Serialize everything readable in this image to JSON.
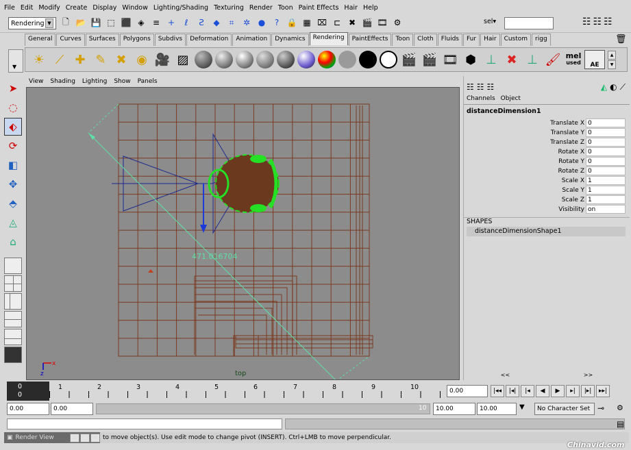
{
  "menu": [
    "File",
    "Edit",
    "Modify",
    "Create",
    "Display",
    "Window",
    "Lighting/Shading",
    "Texturing",
    "Render",
    "Toon",
    "Paint Effects",
    "Hair",
    "Help"
  ],
  "status": {
    "mode": "Rendering",
    "sel_label": "sel▾"
  },
  "shelf_tabs": [
    "General",
    "Curves",
    "Surfaces",
    "Polygons",
    "Subdivs",
    "Deformation",
    "Animation",
    "Dynamics",
    "Rendering",
    "PaintEffects",
    "Toon",
    "Cloth",
    "Fluids",
    "Fur",
    "Hair",
    "Custom",
    "rigg"
  ],
  "active_tab": "Rendering",
  "shelf_text": {
    "mel": "mel",
    "mel_sub": "used",
    "ae": "AE"
  },
  "panel_menu": [
    "View",
    "Shading",
    "Lighting",
    "Show",
    "Panels"
  ],
  "viewport": {
    "camera": "top",
    "measure": "471.016704",
    "axis_x": "x",
    "axis_z": "z"
  },
  "channelbox": {
    "menu": [
      "Channels",
      "Object"
    ],
    "object": "distanceDimension1",
    "attrs": [
      {
        "label": "Translate X",
        "value": "0"
      },
      {
        "label": "Translate Y",
        "value": "0"
      },
      {
        "label": "Translate Z",
        "value": "0"
      },
      {
        "label": "Rotate X",
        "value": "0"
      },
      {
        "label": "Rotate Y",
        "value": "0"
      },
      {
        "label": "Rotate Z",
        "value": "0"
      },
      {
        "label": "Scale X",
        "value": "1"
      },
      {
        "label": "Scale Y",
        "value": "1"
      },
      {
        "label": "Scale Z",
        "value": "1"
      },
      {
        "label": "Visibility",
        "value": "on"
      }
    ],
    "shapes_header": "SHAPES",
    "shape_name": "distanceDimensionShape1",
    "scroll_left": "<<",
    "scroll_right": ">>"
  },
  "timeline": {
    "current": "0",
    "current2": "0",
    "ticks": [
      "1",
      "2",
      "3",
      "4",
      "5",
      "6",
      "7",
      "8",
      "9",
      "10"
    ],
    "current_time": "0.00"
  },
  "range": {
    "start": "0.00",
    "anim_start": "0.00",
    "range_end_label": "10",
    "anim_end": "10.00",
    "end": "10.00",
    "char_set": "No Character Set"
  },
  "help": {
    "render_view": "Render View",
    "text": "to move object(s). Use edit mode to change pivot (INSERT). Ctrl+LMB to move perpendicular."
  },
  "watermark": "Chinavid.com"
}
